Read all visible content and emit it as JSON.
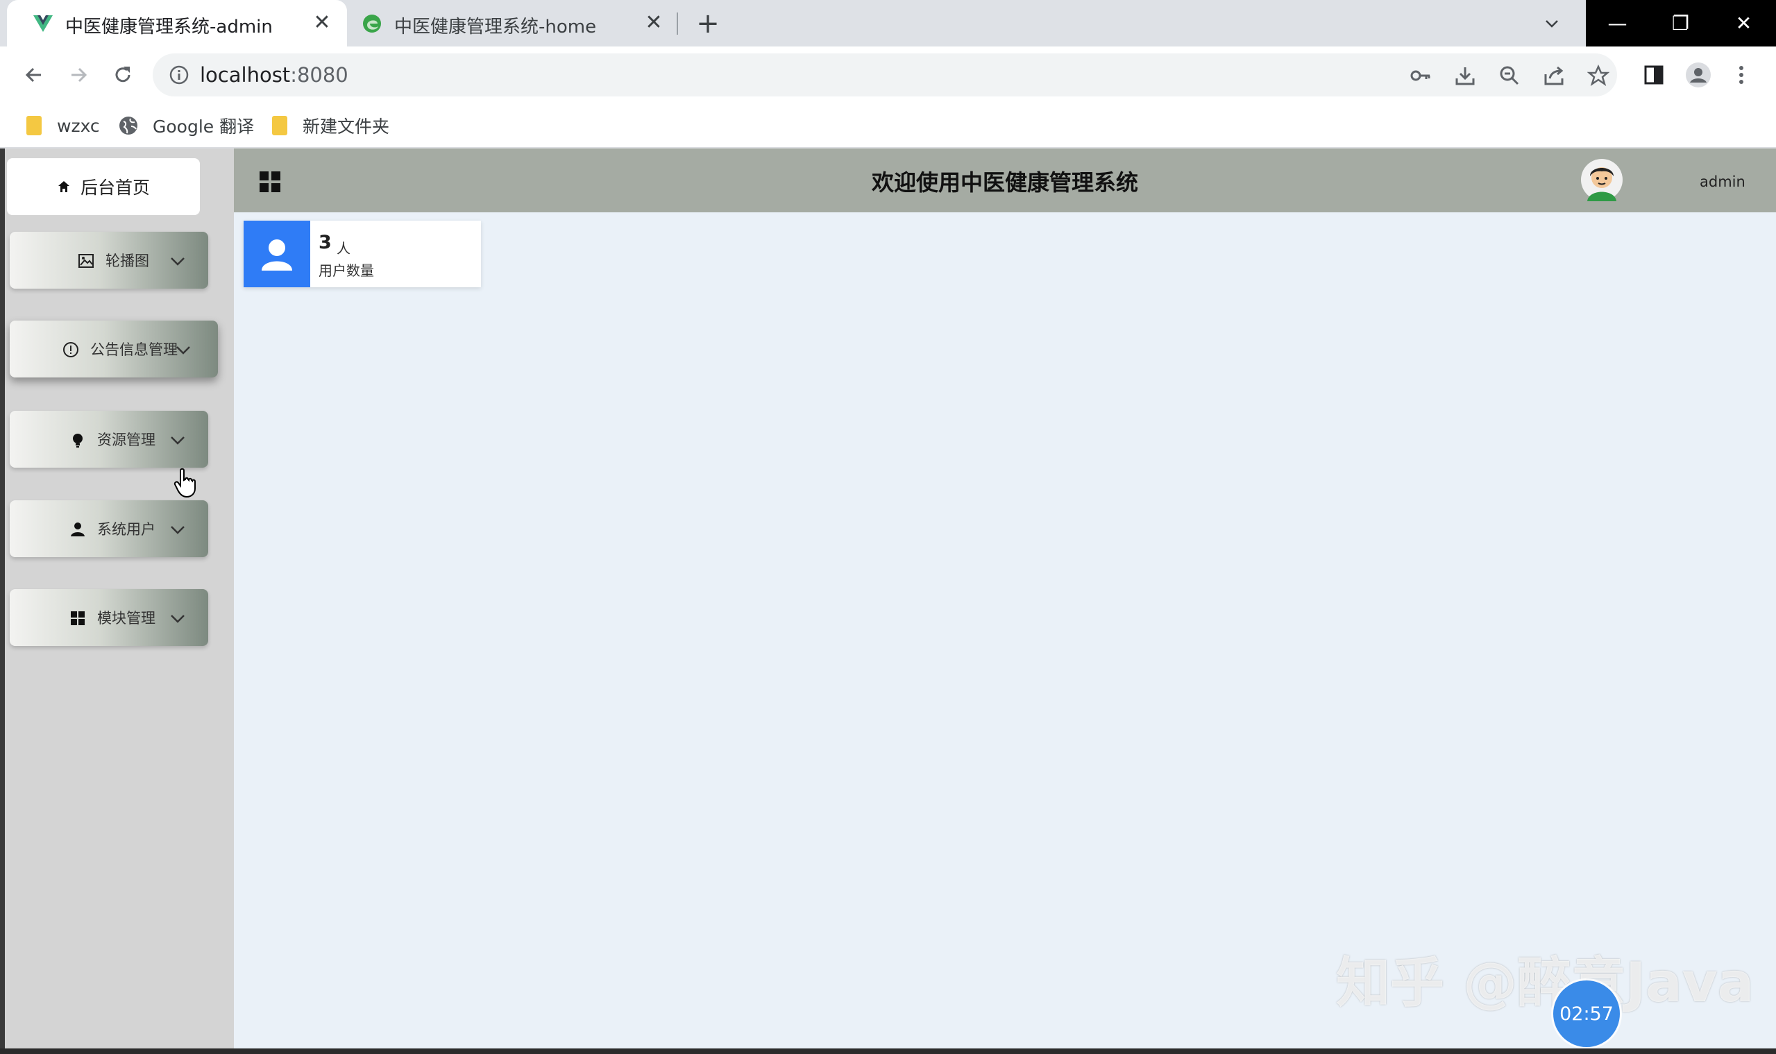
{
  "browser": {
    "tabs": [
      {
        "title": "中医健康管理系统-admin",
        "active": true,
        "favicon": "vue-icon"
      },
      {
        "title": "中医健康管理系统-home",
        "active": false,
        "favicon": "edge-icon"
      }
    ],
    "close_glyph": "✕",
    "new_tab_glyph": "+",
    "tab_list_glyph": "⌄",
    "window_controls": {
      "minimize": "—",
      "restore": "❐",
      "close": "✕"
    },
    "url": {
      "host": "localhost",
      "port": ":8080"
    },
    "bookmarks": [
      {
        "label": "wzxc",
        "icon": "folder-icon"
      },
      {
        "label": "Google 翻译",
        "icon": "globe-icon"
      },
      {
        "label": "新建文件夹",
        "icon": "folder-icon"
      }
    ]
  },
  "sidebar": {
    "home": "后台首页",
    "items": [
      {
        "label": "轮播图",
        "icon": "image-icon"
      },
      {
        "label": "公告信息管理",
        "icon": "info-circle-icon"
      },
      {
        "label": "资源管理",
        "icon": "bulb-icon"
      },
      {
        "label": "系统用户",
        "icon": "user-icon"
      },
      {
        "label": "模块管理",
        "icon": "grid-icon"
      }
    ]
  },
  "header": {
    "title": "欢迎使用中医健康管理系统",
    "username": "admin"
  },
  "dashboard": {
    "user_count": "3",
    "user_unit": "人",
    "user_label": "用户数量"
  },
  "overlay": {
    "watermark": "知乎 @醉意Java",
    "timer": "02:57"
  },
  "colors": {
    "accent": "#2f7cf6",
    "header_bg": "#a5aba3",
    "sidebar_bg": "#d4d4d4",
    "content_bg": "#eaf1f8"
  }
}
